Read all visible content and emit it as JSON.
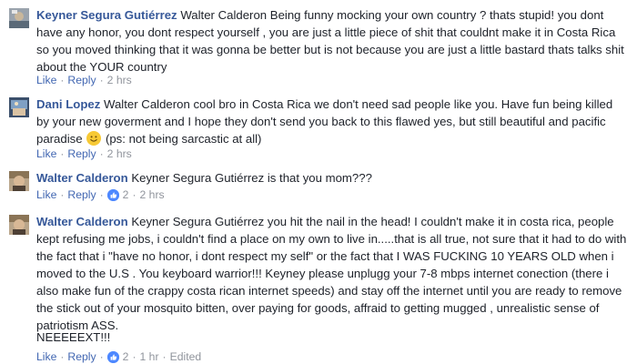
{
  "comments": [
    {
      "author": "Keyner Segura Gutiérrez",
      "text": "Walter Calderon Being funny mocking your own country ? thats stupid! you dont have any honor, you dont respect yourself , you are just a little piece of shit that couldnt make it in Costa Rica so you moved thinking that it was gonna be better but is not because you are just a little bastard thats talks shit about the YOUR country",
      "like": "Like",
      "reply": "Reply",
      "time": "2 hrs"
    },
    {
      "author": "Dani Lopez",
      "text": "Walter Calderon cool bro in Costa Rica we don't need sad people like you. Have fun being killed by your new goverment and I hope they don't send you back to this flawed yes, but still beautiful and pacific paradise",
      "text_after_emoji": "(ps: not being sarcastic at all)",
      "like": "Like",
      "reply": "Reply",
      "time": "2 hrs"
    },
    {
      "author": "Walter Calderon",
      "text": "Keyner Segura Gutiérrez is that you mom???",
      "like": "Like",
      "reply": "Reply",
      "reactions": "2",
      "time": "2 hrs"
    },
    {
      "author": "Walter Calderon",
      "text": "Keyner Segura Gutiérrez you hit the nail in the head! I couldn't make it in costa rica, people kept refusing me jobs, i couldn't find a place on my own to live in.....that is all true, not sure that it had to do with the fact that i \"have no honor, i dont respect my self\" or the fact that I WAS FUCKING 10 YEARS OLD when i moved to the U.S . You keyboard warrior!!! Keyney please unplugg your 7-8 mbps internet conection (there i also make fun of the crappy costa rican internet speeds) and stay off the internet until you are ready to remove the stick out of your mosquito bitten, over paying for goods, affraid to getting mugged , unrealistic sense of patriotism ASS.",
      "extra": "NEEEEEXT!!!",
      "like": "Like",
      "reply": "Reply",
      "reactions": "2",
      "time": "1 hr",
      "edited": "Edited"
    }
  ],
  "colors": {
    "link": "#365899",
    "meta_link": "#4267b2",
    "meta_text": "#90949c",
    "like_badge": "#4d88ff"
  },
  "icons": {
    "like_badge": "thumbs-up-icon",
    "emoji": "smiley-emoji-icon"
  }
}
